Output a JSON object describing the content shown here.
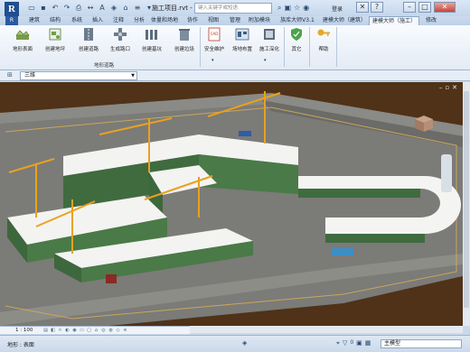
{
  "app": {
    "logo_letter": "R",
    "document_title": "施工项目.rvt -",
    "search_placeholder": "键入关键字或短语",
    "login": "登录"
  },
  "tabs": [
    {
      "label": "R"
    },
    {
      "label": "建筑"
    },
    {
      "label": "结构"
    },
    {
      "label": "系统"
    },
    {
      "label": "插入"
    },
    {
      "label": "注释"
    },
    {
      "label": "分析"
    },
    {
      "label": "体量和场地"
    },
    {
      "label": "协作"
    },
    {
      "label": "视图"
    },
    {
      "label": "管理"
    },
    {
      "label": "附加模块"
    },
    {
      "label": "族库大师V3.1"
    },
    {
      "label": "建模大师（建筑）"
    },
    {
      "label": "建模大师（施工）"
    },
    {
      "label": "修改"
    }
  ],
  "ribbon": {
    "buttons": [
      {
        "label": "地形表面"
      },
      {
        "label": "创建地坪"
      },
      {
        "label": "创建道路"
      },
      {
        "label": "生成路口"
      },
      {
        "label": "创建基坑"
      },
      {
        "label": "创建垃圾"
      },
      {
        "label": "安全维护"
      },
      {
        "label": "场地布置"
      },
      {
        "label": "施工深化"
      },
      {
        "label": "其它"
      },
      {
        "label": "帮助"
      }
    ],
    "panel_label": "地形道路"
  },
  "properties": {
    "view_type": "三维"
  },
  "viewbar": {
    "scale": "1 : 100"
  },
  "status": {
    "text": "地形 : 表面",
    "model_selector": "主模型",
    "filter_count": "0"
  },
  "colors": {
    "ground": "#4f3218",
    "road": "#6e6e6e",
    "building_wall": "#3f6b3f",
    "crane": "#e8a21e",
    "roof": "#f4f4f2"
  }
}
